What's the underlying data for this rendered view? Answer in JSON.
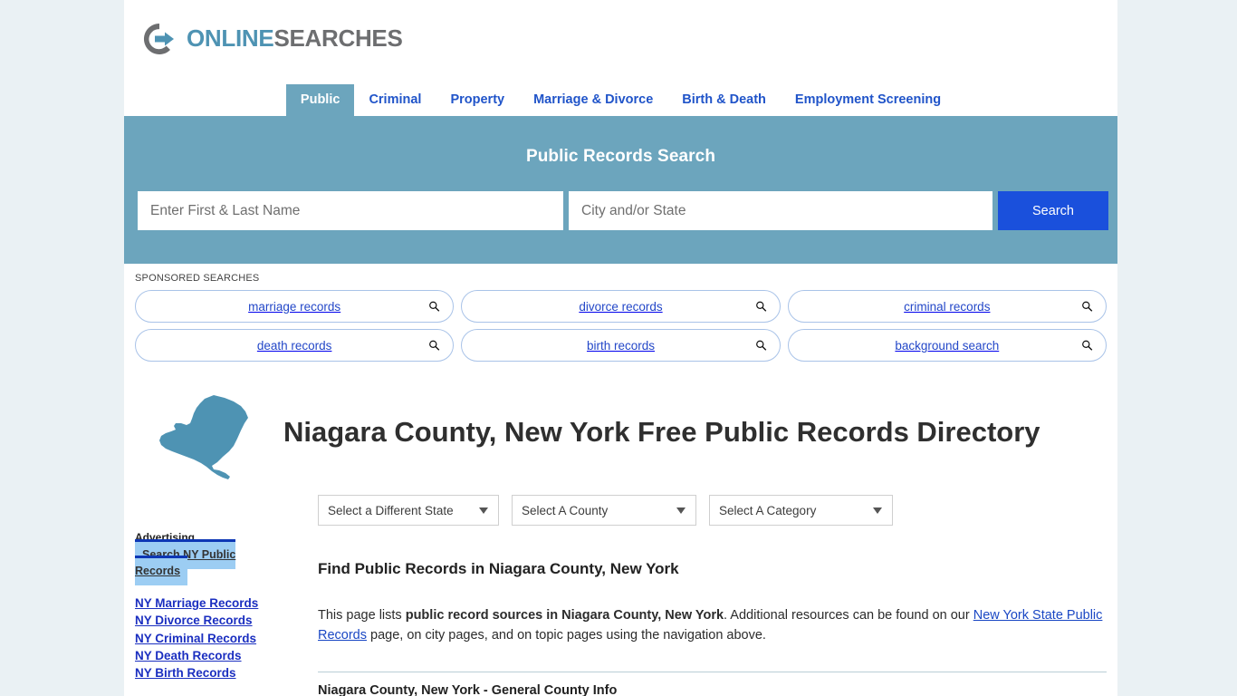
{
  "brand": {
    "logo_icon": "circle-arrow-logo-icon",
    "name_part1": "ONLINE",
    "name_part2": "SEARCHES",
    "color_blue": "#4e93b3",
    "color_gray": "#6d6e70"
  },
  "nav": {
    "items": [
      {
        "label": "Public",
        "active": true
      },
      {
        "label": "Criminal",
        "active": false
      },
      {
        "label": "Property",
        "active": false
      },
      {
        "label": "Marriage & Divorce",
        "active": false
      },
      {
        "label": "Birth & Death",
        "active": false
      },
      {
        "label": "Employment Screening",
        "active": false
      }
    ]
  },
  "hero": {
    "title": "Public Records Search",
    "name_placeholder": "Enter First & Last Name",
    "name_value": "",
    "location_placeholder": "City and/or State",
    "location_value": "",
    "search_label": "Search",
    "background_color": "#6ca5bd",
    "button_color": "#1a50dc"
  },
  "sponsored": {
    "label": "SPONSORED SEARCHES",
    "rows": [
      [
        {
          "label": "marriage records"
        },
        {
          "label": "divorce records"
        },
        {
          "label": "criminal records"
        }
      ],
      [
        {
          "label": "death records"
        },
        {
          "label": "birth records"
        },
        {
          "label": "background search"
        }
      ]
    ]
  },
  "page": {
    "map_icon": "new-york-state-map-icon",
    "title": "Niagara County, New York Free Public Records Directory"
  },
  "selects": [
    {
      "name": "state",
      "value": "Select a Different State"
    },
    {
      "name": "county",
      "value": "Select A County"
    },
    {
      "name": "category",
      "value": "Select A Category"
    }
  ],
  "main": {
    "section_heading": "Find Public Records in Niagara County, New York",
    "paragraph": {
      "part1": "This page lists ",
      "bold1": "public record sources in Niagara County, New York",
      "part2": ". Additional resources can be found on our ",
      "link1": "New York State Public Records",
      "part3": " page, on city pages, and on topic pages using the navigation above."
    },
    "sub_heading": "Niagara County, New York - General County Info"
  },
  "sidebar": {
    "ad_label": "Advertising",
    "ad_box_text": "Search NY Public Records",
    "links": [
      {
        "label": "NY Marriage Records"
      },
      {
        "label": "NY Divorce Records"
      },
      {
        "label": "NY Criminal Records"
      },
      {
        "label": "NY Death Records"
      },
      {
        "label": "NY Birth Records"
      }
    ]
  }
}
